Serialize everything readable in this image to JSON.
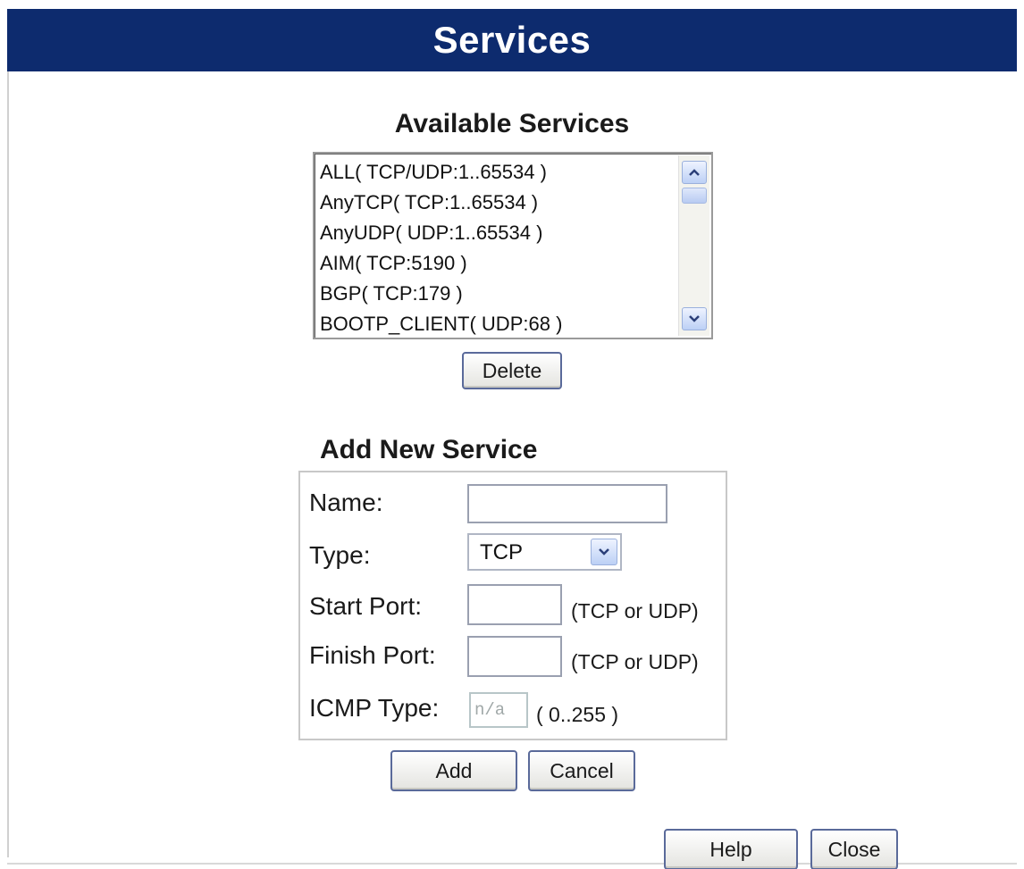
{
  "header": {
    "title": "Services"
  },
  "available_services": {
    "heading": "Available Services",
    "items": [
      "ALL( TCP/UDP:1..65534 )",
      "AnyTCP( TCP:1..65534 )",
      "AnyUDP( UDP:1..65534 )",
      "AIM( TCP:5190 )",
      "BGP( TCP:179 )",
      "BOOTP_CLIENT( UDP:68 )"
    ],
    "delete_label": "Delete"
  },
  "add_new_service": {
    "heading": "Add New Service",
    "name_label": "Name:",
    "name_value": "",
    "type_label": "Type:",
    "type_selected": "TCP",
    "start_port_label": "Start Port:",
    "start_port_value": "",
    "start_port_hint": "(TCP or UDP)",
    "finish_port_label": "Finish Port:",
    "finish_port_value": "",
    "finish_port_hint": "(TCP or UDP)",
    "icmp_type_label": "ICMP Type:",
    "icmp_type_placeholder": "n/a",
    "icmp_type_hint": "( 0..255 )",
    "add_label": "Add",
    "cancel_label": "Cancel"
  },
  "footer": {
    "help_label": "Help",
    "close_label": "Close"
  },
  "icons": {
    "scroll_up": "chevron-up-icon",
    "scroll_down": "chevron-down-icon",
    "select_arrow": "chevron-down-icon"
  },
  "colors": {
    "header_background": "#0d2b6e",
    "header_text": "#ffffff",
    "button_border": "#5a6a9a",
    "scroll_accent": "#bcd0f5"
  }
}
